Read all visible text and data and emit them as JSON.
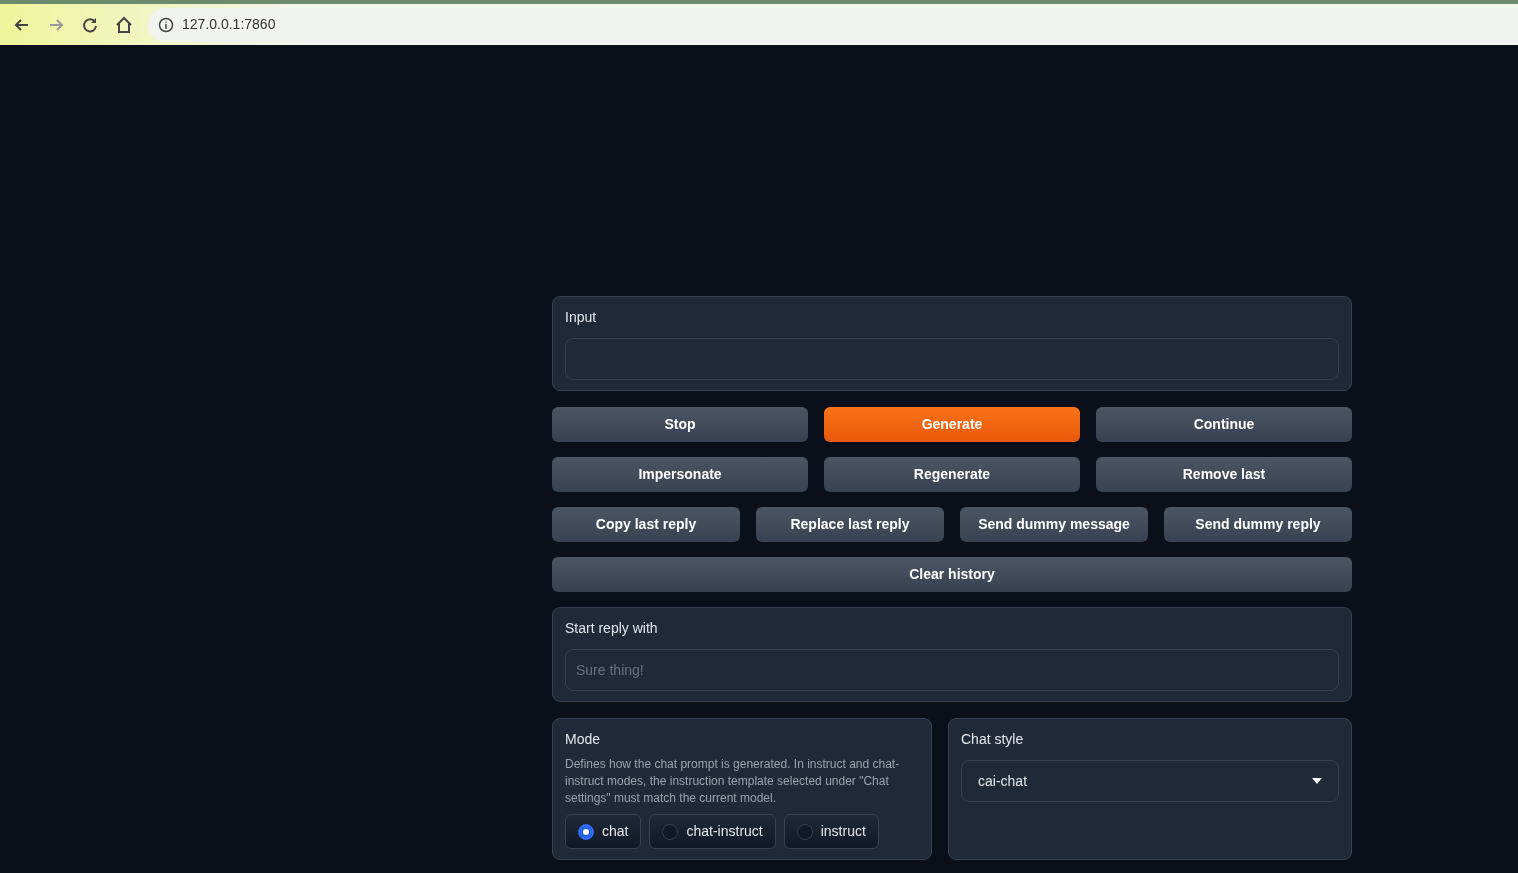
{
  "browser": {
    "address": "127.0.0.1:7860"
  },
  "input": {
    "label": "Input"
  },
  "button_rows": [
    [
      {
        "label": "Stop",
        "kind": "secondary"
      },
      {
        "label": "Generate",
        "kind": "primary"
      },
      {
        "label": "Continue",
        "kind": "secondary"
      }
    ],
    [
      {
        "label": "Impersonate",
        "kind": "secondary"
      },
      {
        "label": "Regenerate",
        "kind": "secondary"
      },
      {
        "label": "Remove last",
        "kind": "secondary"
      }
    ],
    [
      {
        "label": "Copy last reply",
        "kind": "secondary"
      },
      {
        "label": "Replace last reply",
        "kind": "secondary"
      },
      {
        "label": "Send dummy message",
        "kind": "secondary"
      },
      {
        "label": "Send dummy reply",
        "kind": "secondary"
      }
    ],
    [
      {
        "label": "Clear history",
        "kind": "secondary"
      }
    ]
  ],
  "start_reply": {
    "label": "Start reply with",
    "placeholder": "Sure thing!"
  },
  "mode": {
    "label": "Mode",
    "description": "Defines how the chat prompt is generated. In instruct and chat-instruct modes, the instruction template selected under \"Chat settings\" must match the current model.",
    "options": [
      {
        "label": "chat",
        "selected": true
      },
      {
        "label": "chat-instruct",
        "selected": false
      },
      {
        "label": "instruct",
        "selected": false
      }
    ]
  },
  "chat_style": {
    "label": "Chat style",
    "value": "cai-chat"
  }
}
